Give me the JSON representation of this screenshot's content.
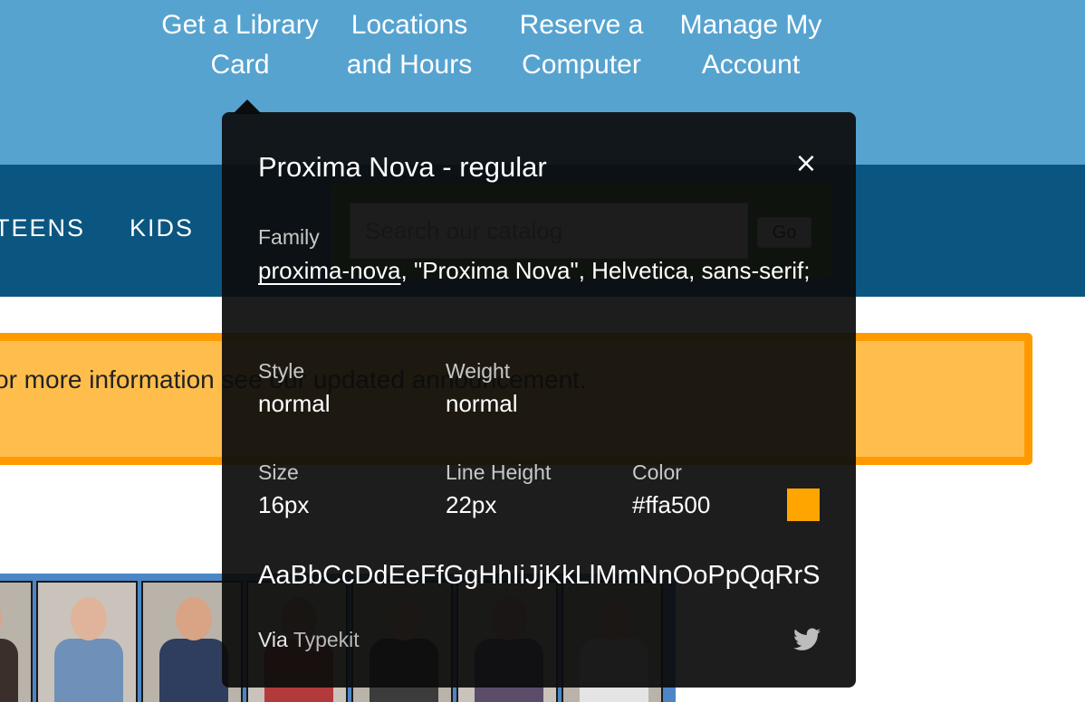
{
  "top_links": [
    {
      "line1": "Get a Library",
      "line2": "Card"
    },
    {
      "line1": "Locations",
      "line2": "and Hours"
    },
    {
      "line1": "Reserve a",
      "line2": "Computer"
    },
    {
      "line1": "Manage My",
      "line2": "Account"
    }
  ],
  "main_nav": {
    "items": [
      "TEENS",
      "KIDS"
    ]
  },
  "search": {
    "placeholder": "Search our catalog",
    "button_label": "Go"
  },
  "banner": {
    "text": "or more information see our updated announcement."
  },
  "photos": [
    {
      "skin": "#d8a48a",
      "cloth": "#3a2f2a"
    },
    {
      "skin": "#e0b49a",
      "cloth": "#6f90b8"
    },
    {
      "skin": "#d9a386",
      "cloth": "#2f3e5e"
    },
    {
      "skin": "#c98f72",
      "cloth": "#b23a3a"
    },
    {
      "skin": "#d7a58b",
      "cloth": "#3c3c3c"
    },
    {
      "skin": "#caa08a",
      "cloth": "#5b4d6a"
    },
    {
      "skin": "#dcae94",
      "cloth": "#e4e4e4"
    }
  ],
  "font_tooltip": {
    "title": "Proxima Nova - regular",
    "close_glyph": "×",
    "family_label": "Family",
    "family_link": "proxima-nova",
    "family_rest": ", \"Proxima Nova\", Helvetica, sans-serif;",
    "style_label": "Style",
    "style_value": "normal",
    "weight_label": "Weight",
    "weight_value": "normal",
    "size_label": "Size",
    "size_value": "16px",
    "line_height_label": "Line Height",
    "line_height_value": "22px",
    "color_label": "Color",
    "color_value": "#ffa500",
    "sample": "AaBbCcDdEeFfGgHhIiJjKkLlMmNnOoPpQqRrSsTtUuVvWwXxYyZz",
    "via_prefix": "Via",
    "via_link": "Typekit",
    "twitter_icon": "twitter-icon"
  },
  "colors": {
    "top_bar": "#56a3d0",
    "main_nav": "#0b5680",
    "banner_fill": "#ffbe4c",
    "banner_border": "#ff9a00",
    "swatch": "#ffa500"
  }
}
